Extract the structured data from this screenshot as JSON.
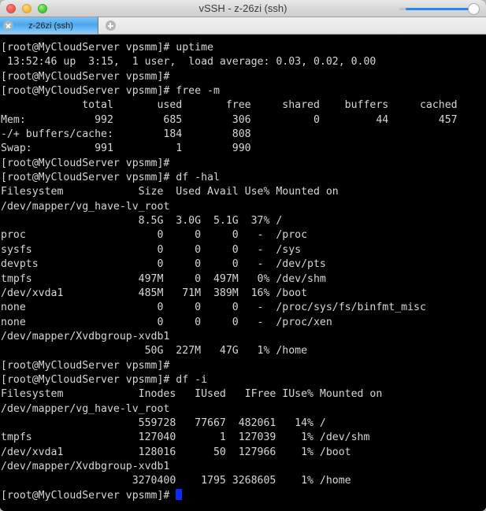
{
  "window": {
    "title": "vSSH - z-26zi (ssh)",
    "traffic_lights": [
      "close-button",
      "minimize-button",
      "maximize-button"
    ],
    "slider": {
      "name": "transparency-slider",
      "value": 100
    }
  },
  "tabbar": {
    "tabs": [
      {
        "label": "z-26zi (ssh)",
        "active": true,
        "close_icon": "close-icon"
      }
    ],
    "add_tab_label": "+"
  },
  "terminal": {
    "prompt": "[root@MyCloudServer vpsmm]# ",
    "cursor_color": "#0a2bff",
    "foreground": "#d6d6d6",
    "background": "#000000",
    "lines": [
      "[root@MyCloudServer vpsmm]# uptime",
      " 13:52:46 up  3:15,  1 user,  load average: 0.03, 0.02, 0.00",
      "[root@MyCloudServer vpsmm]#",
      "[root@MyCloudServer vpsmm]# free -m",
      "             total       used       free     shared    buffers     cached",
      "Mem:           992        685        306          0         44        457",
      "-/+ buffers/cache:        184        808",
      "Swap:          991          1        990",
      "[root@MyCloudServer vpsmm]#",
      "[root@MyCloudServer vpsmm]# df -hal",
      "Filesystem            Size  Used Avail Use% Mounted on",
      "/dev/mapper/vg_have-lv_root",
      "                      8.5G  3.0G  5.1G  37% /",
      "proc                     0     0     0   -  /proc",
      "sysfs                    0     0     0   -  /sys",
      "devpts                   0     0     0   -  /dev/pts",
      "tmpfs                 497M     0  497M   0% /dev/shm",
      "/dev/xvda1            485M   71M  389M  16% /boot",
      "none                     0     0     0   -  /proc/sys/fs/binfmt_misc",
      "none                     0     0     0   -  /proc/xen",
      "/dev/mapper/Xvdbgroup-xvdb1",
      "                       50G  227M   47G   1% /home",
      "[root@MyCloudServer vpsmm]#",
      "[root@MyCloudServer vpsmm]# df -i",
      "Filesystem            Inodes   IUsed   IFree IUse% Mounted on",
      "/dev/mapper/vg_have-lv_root",
      "                      559728   77667  482061   14% /",
      "tmpfs                 127040       1  127039    1% /dev/shm",
      "/dev/xvda1            128016      50  127966    1% /boot",
      "/dev/mapper/Xvdbgroup-xvdb1",
      "                     3270400    1795 3268605    1% /home"
    ],
    "last_prompt": "[root@MyCloudServer vpsmm]# "
  }
}
